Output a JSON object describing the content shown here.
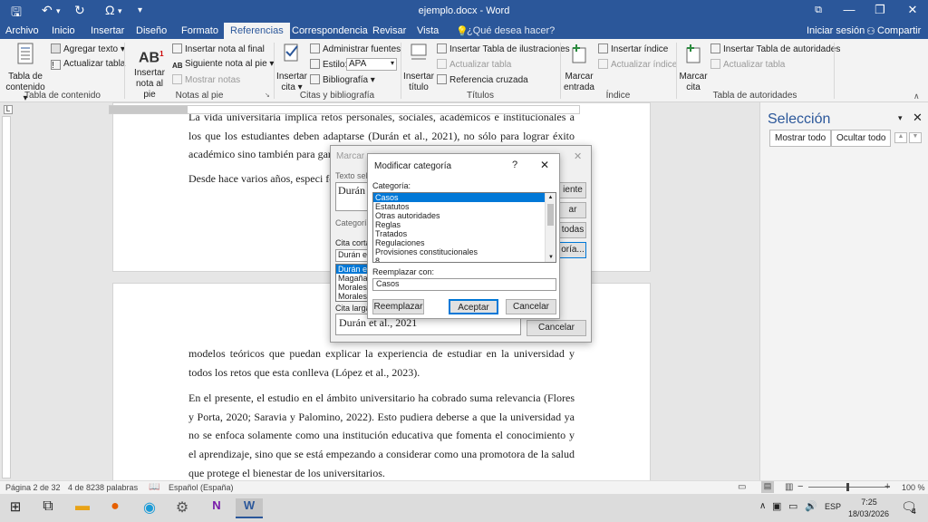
{
  "window": {
    "title": "ejemplo.docx - Word"
  },
  "qat": {
    "save": "🖫",
    "undo": "↶",
    "redo": "↻",
    "omega": "Ω",
    "customize": "▾"
  },
  "wincontrols": {
    "restore": "⧉",
    "minimize": "—",
    "maximize": "❐",
    "close": "✕"
  },
  "tabs": [
    "Archivo",
    "Inicio",
    "Insertar",
    "Diseño",
    "Formato",
    "Referencias",
    "Correspondencia",
    "Revisar",
    "Vista"
  ],
  "tellme": "¿Qué desea hacer?",
  "signin": "Iniciar sesión",
  "share": "Compartir",
  "ribbon": {
    "toc": {
      "big_l1": "Tabla de",
      "big_l2": "contenido",
      "add_text": "Agregar texto",
      "update": "Actualizar tabla",
      "group": "Tabla de contenido"
    },
    "footnotes": {
      "big_l1": "Insertar",
      "big_l2": "nota al pie",
      "insert_endnote": "Insertar nota al final",
      "next_footnote": "Siguiente nota al pie",
      "show_notes": "Mostrar notas",
      "group": "Notas al pie"
    },
    "citations": {
      "big_l1": "Insertar",
      "big_l2": "cita",
      "manage": "Administrar fuentes",
      "style_label": "Estilo:",
      "style_value": "APA",
      "bibliography": "Bibliografía",
      "group": "Citas y bibliografía"
    },
    "captions": {
      "big_l1": "Insertar",
      "big_l2": "título",
      "insert_table_fig": "Insertar Tabla de ilustraciones",
      "update": "Actualizar tabla",
      "cross_ref": "Referencia cruzada",
      "group": "Títulos"
    },
    "index": {
      "big_l1": "Marcar",
      "big_l2": "entrada",
      "insert_index": "Insertar índice",
      "update": "Actualizar índice",
      "group": "Índice"
    },
    "authorities": {
      "big_l1": "Marcar",
      "big_l2": "cita",
      "insert_table": "Insertar Tabla de autoridades",
      "update": "Actualizar tabla",
      "group": "Tabla de autoridades"
    }
  },
  "document": {
    "p1": "La vida universitaria implica retos personales, sociales, académicos e institucionales a los que los estudiantes deben adaptarse (Durán et al., 2021), no sólo para lograr éxito académico sino también para gar",
    "p2": "Desde hace varios años, especi fenómeno de la adaptación unive",
    "p3": "modelos teóricos que puedan explicar la experiencia de estudiar en la universidad y todos los retos que esta conlleva (López et al., 2023).",
    "p4": "En el presente, el estudio en el ámbito universitario ha cobrado suma relevancia (Flores y Porta, 2020; Saravia y Palomino, 2022). Esto pudiera deberse a que la universidad ya no se enfoca solamente como una institución educativa que fomenta el conocimiento y el aprendizaje, sino que se está empezando a considerar como una promotora de la salud que protege el bienestar de los universitarios."
  },
  "pane": {
    "title": "Selección",
    "show_all": "Mostrar todo",
    "hide_all": "Ocultar todo"
  },
  "mark_citation": {
    "title": "Marcar c",
    "selected_label": "Texto sele",
    "selected_text": "Durán",
    "category_label": "Categoría",
    "short_label": "Cita corta",
    "short_value": "Durán et",
    "short_list": [
      "Durán et",
      "Magaña",
      "Morales",
      "Morales,"
    ],
    "long_label": "Cita larga",
    "long_value": "Durán et al., 2021",
    "btn_next": "iente",
    "btn_mark": "ar",
    "btn_mark_all": "todas",
    "btn_category": "oría...",
    "btn_cancel": "Cancelar"
  },
  "modify_category": {
    "title": "Modificar categoría",
    "help": "?",
    "close": "✕",
    "category_label": "Categoría:",
    "categories": [
      "Casos",
      "Estatutos",
      "Otras autoridades",
      "Reglas",
      "Tratados",
      "Regulaciones",
      "Provisiones constitucionales",
      "8"
    ],
    "selected": "Casos",
    "replace_label": "Reemplazar con:",
    "replace_value": "Casos",
    "btn_replace": "Reemplazar",
    "btn_ok": "Aceptar",
    "btn_cancel": "Cancelar"
  },
  "statusbar": {
    "page": "Página 2 de 32",
    "words": "4 de 8238 palabras",
    "language": "Español (España)",
    "zoom": "100 %",
    "zoom_minus": "−",
    "zoom_plus": "+"
  },
  "taskbar": {
    "time": "7:25",
    "date": "18/03/2026",
    "lang": "ESP",
    "notif_count": "4"
  },
  "colors": {
    "word_blue": "#2b579a",
    "selection_blue": "#0078d7",
    "highlight": "#c8c8c8"
  }
}
